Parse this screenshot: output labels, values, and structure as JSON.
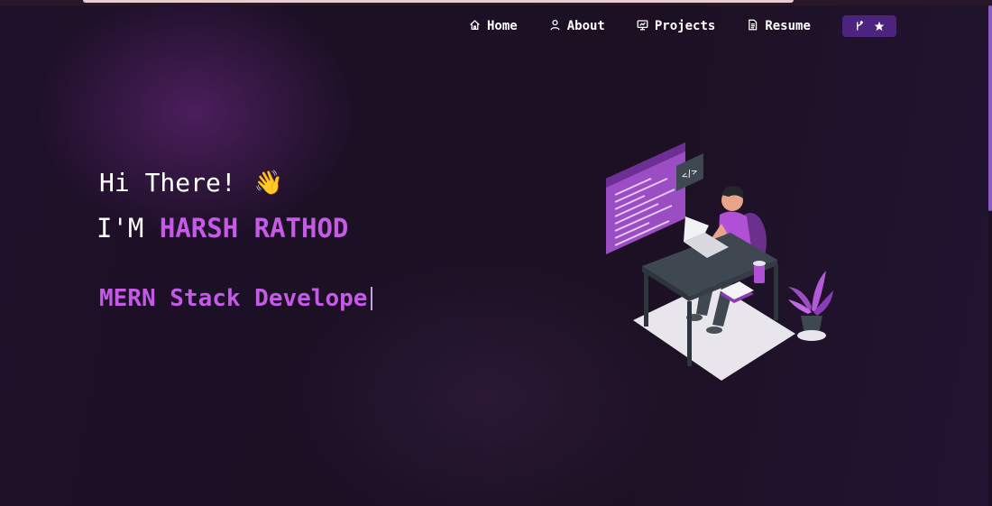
{
  "nav": {
    "items": [
      {
        "label": "Home",
        "icon": "home-icon"
      },
      {
        "label": "About",
        "icon": "user-icon"
      },
      {
        "label": "Projects",
        "icon": "projects-icon"
      },
      {
        "label": "Resume",
        "icon": "document-icon"
      }
    ],
    "button_icons": [
      "fork-icon",
      "star-icon"
    ]
  },
  "hero": {
    "greeting": "Hi There!",
    "wave_emoji": "👋",
    "name_prefix": "I'M",
    "name": "HARSH RATHOD",
    "typed_text": "MERN Stack Develope"
  },
  "colors": {
    "accent": "#c55ae6",
    "nav_button": "#4c2480",
    "background": "#1c1024",
    "scroll_thumb": "#8c5bc4"
  }
}
